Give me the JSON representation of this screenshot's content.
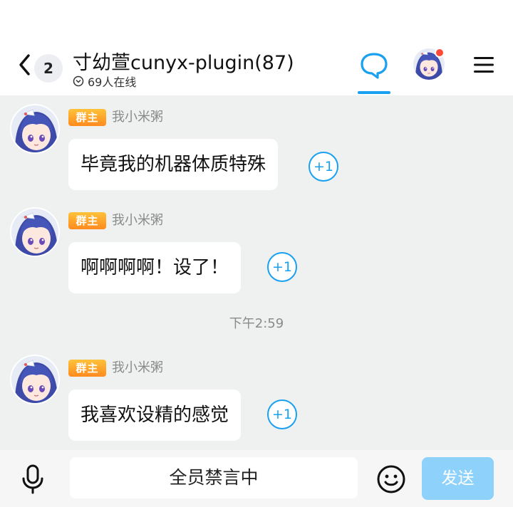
{
  "header": {
    "unread_count": "2",
    "group_name": "寸幼萱cunyx-plugin(87)",
    "online_status": "69人在线",
    "icons": {
      "back": "back-chevron-icon",
      "online": "online-status-icon",
      "chat_tab": "chat-bubble-icon",
      "menu": "hamburger-menu-icon"
    },
    "accent_color": "#1aa0f0",
    "notification_color": "#ff4a3a"
  },
  "messages": [
    {
      "role_badge": "群主",
      "sender": "我小米粥",
      "text": "毕竟我的机器体质特殊",
      "plus_one": "+1"
    },
    {
      "role_badge": "群主",
      "sender": "我小米粥",
      "text": "啊啊啊啊！设了！",
      "plus_one": "+1"
    },
    {
      "role_badge": "群主",
      "sender": "我小米粥",
      "text": "我喜欢设精的感觉",
      "plus_one": "+1"
    }
  ],
  "time_separator": "下午2:59",
  "input_bar": {
    "mute_notice": "全员禁言中",
    "send_label": "发送",
    "icons": {
      "voice": "microphone-icon",
      "emoji": "emoji-smiley-icon"
    },
    "send_color": "#8ed2fb"
  },
  "colors": {
    "chat_background": "#eef1ef",
    "role_badge": "#ffa42c"
  }
}
